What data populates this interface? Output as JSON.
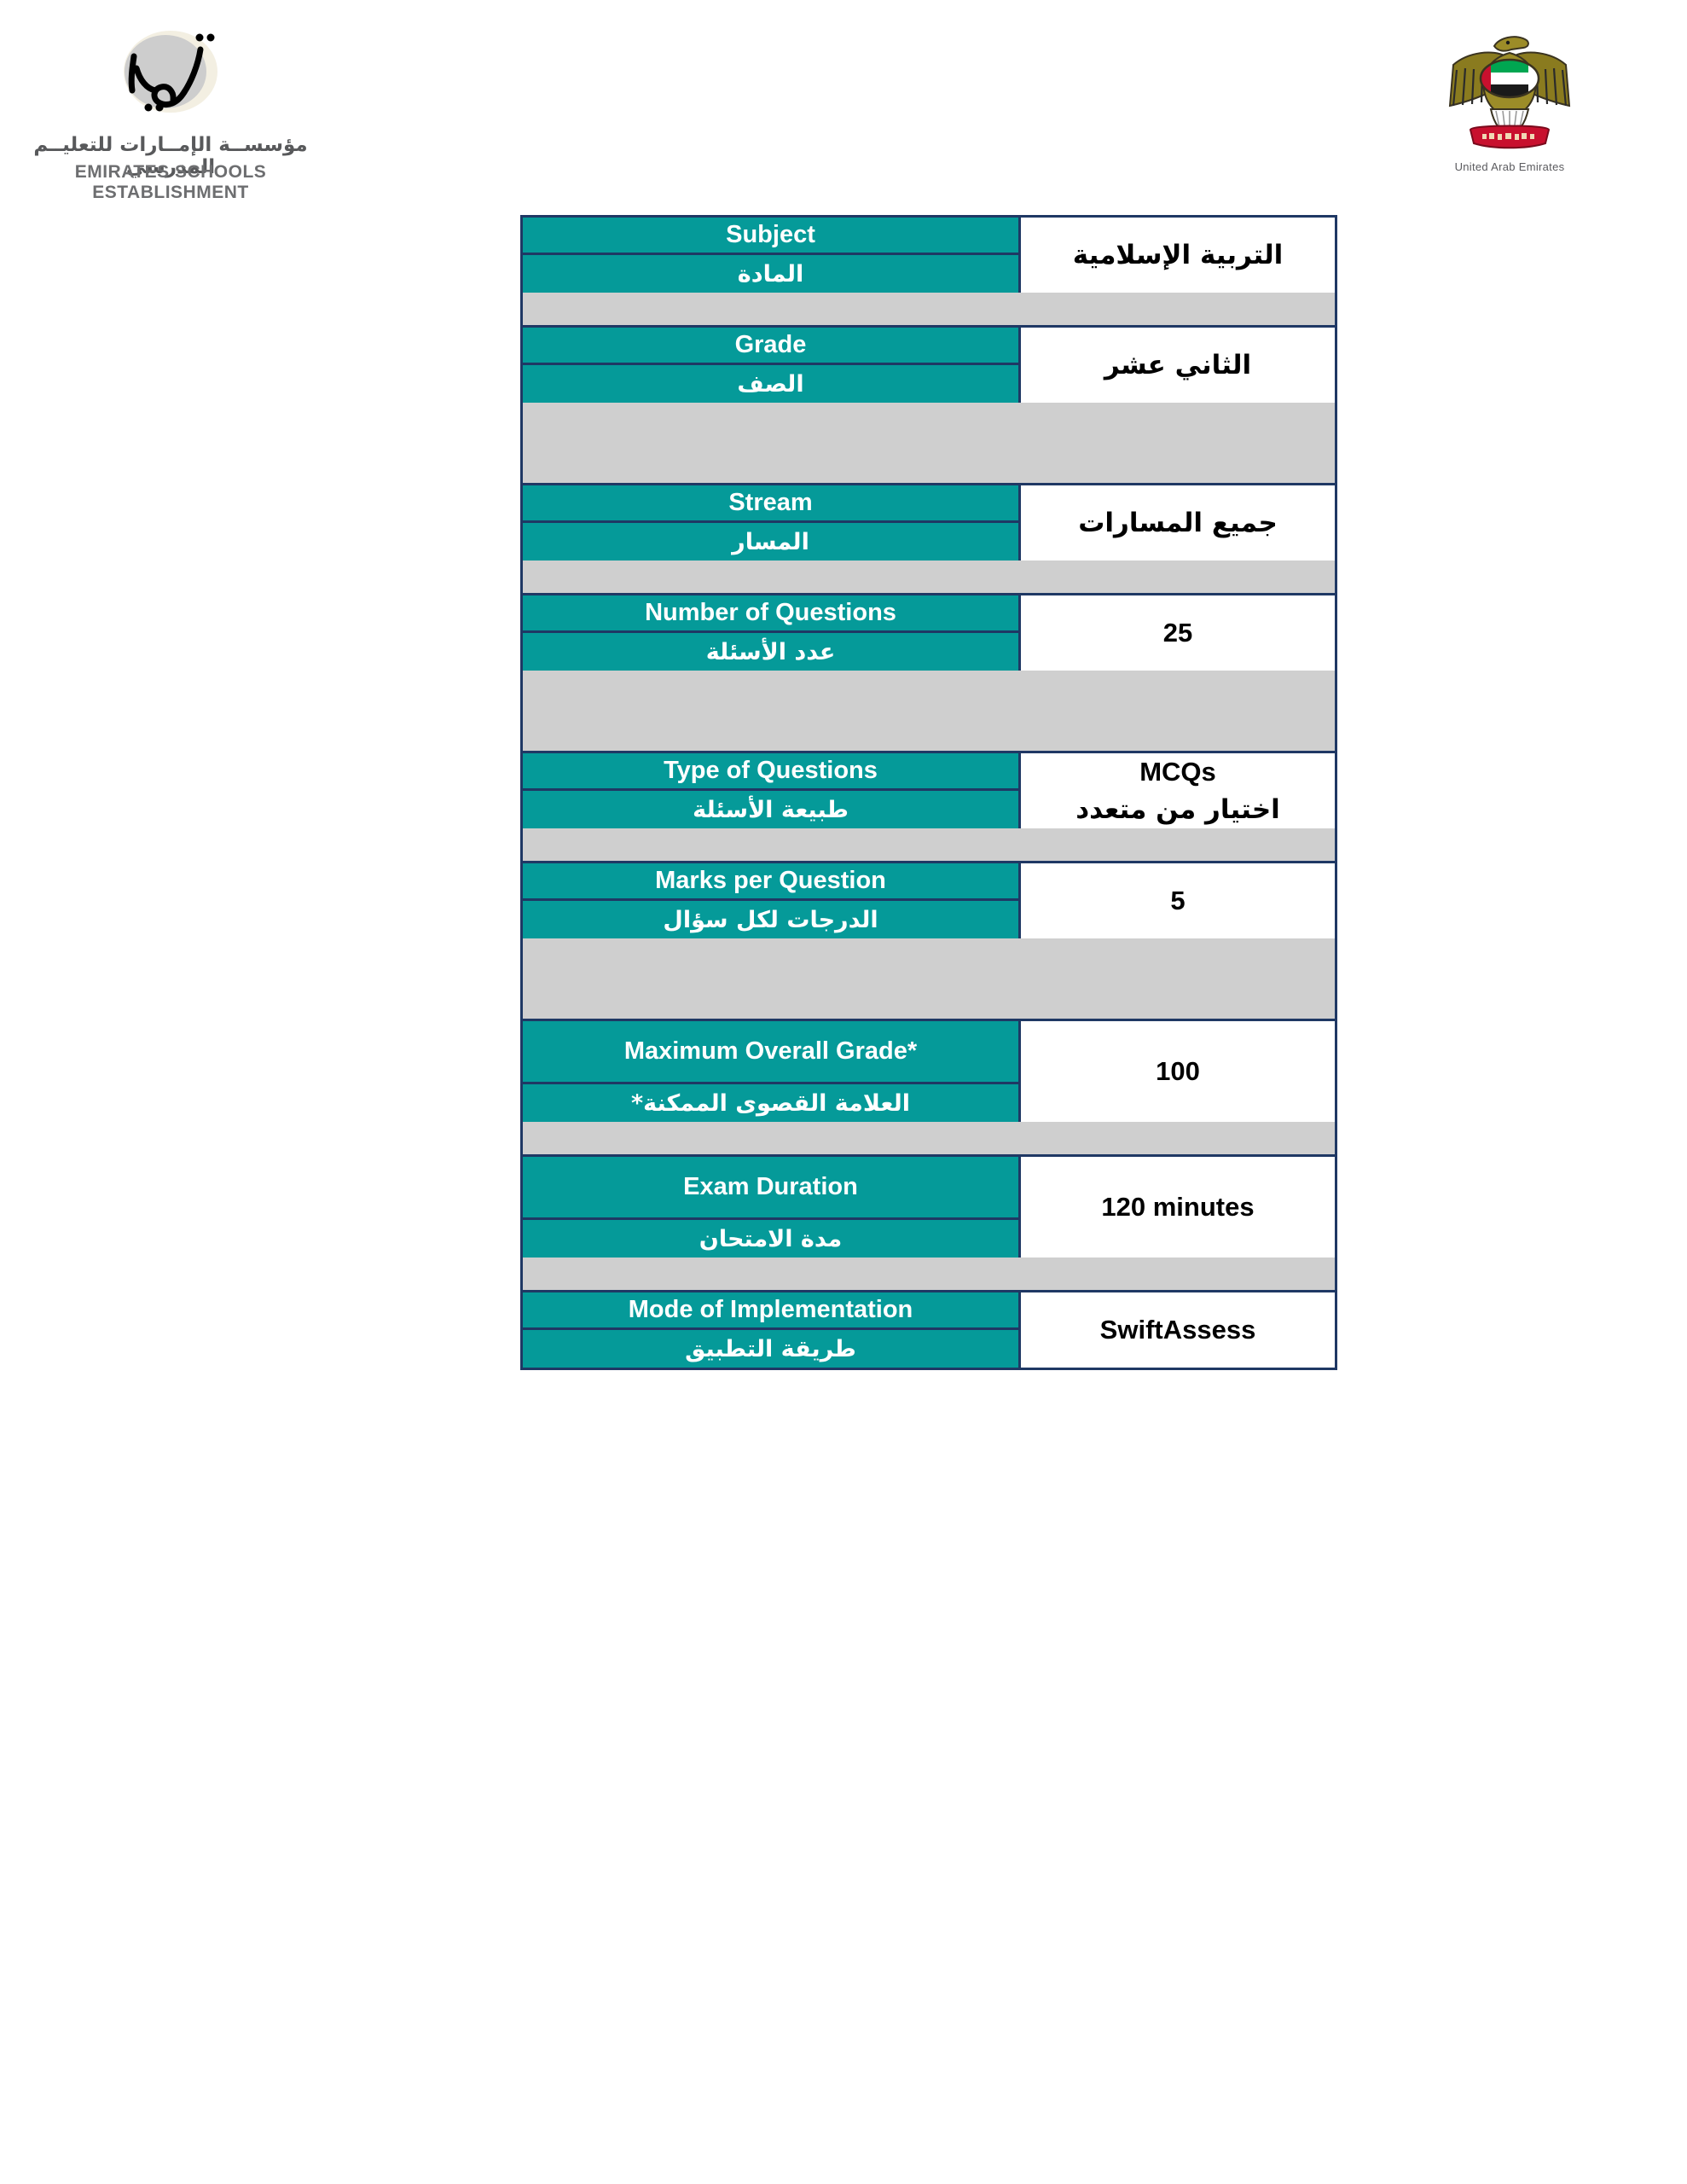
{
  "header": {
    "left_logo": {
      "name": "emirates-schools-establishment-logo",
      "arabic_wordmark": "تعليم",
      "arabic_name": "مؤسســة الإمــارات للتعليــم المدرسي",
      "english_name": "EMIRATES SCHOOLS ESTABLISHMENT"
    },
    "right_logo": {
      "name": "uae-federal-emblem",
      "caption": "United Arab Emirates"
    }
  },
  "colors": {
    "label_teal": "#059A99",
    "border_navy": "#1F3864",
    "spacer_gray": "#CFCFCF",
    "value_bg": "#FFFFFF",
    "label_text": "#FFFFFF",
    "value_text": "#000000"
  },
  "table": {
    "rows": [
      {
        "key": "subject",
        "label_en": "Subject",
        "label_ar": "المادة",
        "value_en": "",
        "value_ar": "التربية الإسلامية",
        "value_lang": "ar",
        "en_h": 44,
        "ar_h": 44,
        "spacer_h": 38
      },
      {
        "key": "grade",
        "label_en": "Grade",
        "label_ar": "الصف",
        "value_en": "",
        "value_ar": "الثاني عشر",
        "value_lang": "ar",
        "en_h": 44,
        "ar_h": 44,
        "spacer_h": 94
      },
      {
        "key": "stream",
        "label_en": "Stream",
        "label_ar": "المسار",
        "value_en": "",
        "value_ar": "جميع المسارات",
        "value_lang": "ar",
        "en_h": 44,
        "ar_h": 44,
        "spacer_h": 38
      },
      {
        "key": "number-of-questions",
        "label_en": "Number of Questions",
        "label_ar": "عدد الأسئلة",
        "value_en": "25",
        "value_ar": "",
        "value_lang": "en",
        "en_h": 44,
        "ar_h": 44,
        "spacer_h": 94
      },
      {
        "key": "type-of-questions",
        "label_en": "Type of Questions",
        "label_ar": "طبيعة الأسئلة",
        "value_en": "MCQs",
        "value_ar": "اختيار من متعدد",
        "value_lang": "both",
        "en_h": 44,
        "ar_h": 44,
        "spacer_h": 38
      },
      {
        "key": "marks-per-question",
        "label_en": "Marks per Question",
        "label_ar": "الدرجات لكل سؤال",
        "value_en": "5",
        "value_ar": "",
        "value_lang": "en",
        "en_h": 44,
        "ar_h": 44,
        "spacer_h": 94
      },
      {
        "key": "maximum-overall-grade",
        "label_en": "Maximum Overall Grade*",
        "label_ar": "العلامة القصوى الممكنة*",
        "value_en": "100",
        "value_ar": "",
        "value_lang": "en",
        "en_h": 74,
        "ar_h": 44,
        "spacer_h": 38
      },
      {
        "key": "exam-duration",
        "label_en": "Exam Duration",
        "label_ar": "مدة الامتحان",
        "value_en": "120 minutes",
        "value_ar": "",
        "value_lang": "en",
        "en_h": 74,
        "ar_h": 44,
        "spacer_h": 38
      },
      {
        "key": "mode-of-implementation",
        "label_en": "Mode of Implementation",
        "label_ar": "طريقة التطبيق",
        "value_en": "SwiftAssess",
        "value_ar": "",
        "value_lang": "en",
        "en_h": 44,
        "ar_h": 44,
        "spacer_h": 0
      }
    ]
  }
}
